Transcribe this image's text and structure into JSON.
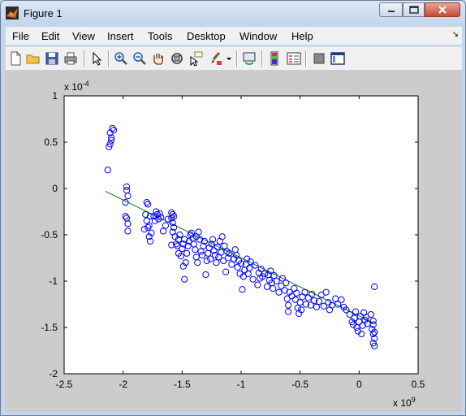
{
  "window": {
    "title": "Figure 1"
  },
  "menu": {
    "items": [
      "File",
      "Edit",
      "View",
      "Insert",
      "Tools",
      "Desktop",
      "Window",
      "Help"
    ]
  },
  "toolbar": {
    "buttons": [
      "new-figure",
      "open-file",
      "save-figure",
      "print-figure",
      "edit-plot",
      "zoom-in",
      "zoom-out",
      "pan",
      "rotate-3d",
      "data-cursor",
      "brush",
      "link-plot",
      "insert-colorbar",
      "insert-legend",
      "hide-plot-tools",
      "show-plot-tools"
    ]
  },
  "chart_data": {
    "type": "scatter",
    "xlim": [
      -2.5,
      0.5
    ],
    "ylim": [
      -2,
      1
    ],
    "x_ticks": [
      "-2.5",
      "-2",
      "-1.5",
      "-1",
      "-0.5",
      "0",
      "0.5"
    ],
    "y_ticks": [
      "1",
      "0.5",
      "0",
      "-0.5",
      "-1",
      "-1.5",
      "-2"
    ],
    "x_exponent": {
      "base": "x 10",
      "exp": "9"
    },
    "y_exponent": {
      "base": "x 10",
      "exp": "-4"
    },
    "marker_color": "#0000ff",
    "line_color": "#008000",
    "fit_line": {
      "x": [
        -2.15,
        0.12
      ],
      "y": [
        -0.03,
        -1.45
      ]
    },
    "points": [
      [
        -2.12,
        0.45
      ],
      [
        -2.11,
        0.48
      ],
      [
        -2.1,
        0.55
      ],
      [
        -2.09,
        0.65
      ],
      [
        -2.08,
        0.63
      ],
      [
        -2.11,
        0.6
      ],
      [
        -2.1,
        0.52
      ],
      [
        -2.13,
        0.2
      ],
      [
        -1.97,
        0.02
      ],
      [
        -1.97,
        -0.02
      ],
      [
        -1.96,
        -0.08
      ],
      [
        -1.98,
        -0.15
      ],
      [
        -1.97,
        -0.32
      ],
      [
        -1.96,
        -0.38
      ],
      [
        -1.98,
        -0.3
      ],
      [
        -1.96,
        -0.46
      ],
      [
        -1.8,
        -0.15
      ],
      [
        -1.79,
        -0.17
      ],
      [
        -1.81,
        -0.28
      ],
      [
        -1.8,
        -0.35
      ],
      [
        -1.79,
        -0.42
      ],
      [
        -1.82,
        -0.44
      ],
      [
        -1.78,
        -0.4
      ],
      [
        -1.77,
        -0.3
      ],
      [
        -1.78,
        -0.52
      ],
      [
        -1.77,
        -0.57
      ],
      [
        -1.76,
        -0.48
      ],
      [
        -1.74,
        -0.3
      ],
      [
        -1.73,
        -0.35
      ],
      [
        -1.72,
        -0.25
      ],
      [
        -1.71,
        -0.28
      ],
      [
        -1.7,
        -0.33
      ],
      [
        -1.69,
        -0.27
      ],
      [
        -1.68,
        -0.31
      ],
      [
        -1.66,
        -0.46
      ],
      [
        -1.64,
        -0.4
      ],
      [
        -1.62,
        -0.33
      ],
      [
        -1.59,
        -0.26
      ],
      [
        -1.58,
        -0.28
      ],
      [
        -1.59,
        -0.32
      ],
      [
        -1.58,
        -0.37
      ],
      [
        -1.57,
        -0.42
      ],
      [
        -1.57,
        -0.3
      ],
      [
        -1.58,
        -0.47
      ],
      [
        -1.56,
        -0.52
      ],
      [
        -1.59,
        -0.61
      ],
      [
        -1.55,
        -0.6
      ],
      [
        -1.54,
        -0.62
      ],
      [
        -1.53,
        -0.55
      ],
      [
        -1.52,
        -0.5
      ],
      [
        -1.53,
        -0.7
      ],
      [
        -1.51,
        -0.73
      ],
      [
        -1.5,
        -0.65
      ],
      [
        -1.49,
        -0.6
      ],
      [
        -1.48,
        -0.55
      ],
      [
        -1.49,
        -0.84
      ],
      [
        -1.48,
        -0.98
      ],
      [
        -1.47,
        -0.8
      ],
      [
        -1.46,
        -0.7
      ],
      [
        -1.45,
        -0.62
      ],
      [
        -1.44,
        -0.57
      ],
      [
        -1.43,
        -0.5
      ],
      [
        -1.42,
        -0.48
      ],
      [
        -1.41,
        -0.54
      ],
      [
        -1.4,
        -0.6
      ],
      [
        -1.39,
        -0.66
      ],
      [
        -1.38,
        -0.74
      ],
      [
        -1.37,
        -0.8
      ],
      [
        -1.38,
        -0.52
      ],
      [
        -1.36,
        -0.47
      ],
      [
        -1.35,
        -0.55
      ],
      [
        -1.34,
        -0.68
      ],
      [
        -1.33,
        -0.72
      ],
      [
        -1.32,
        -0.62
      ],
      [
        -1.31,
        -0.57
      ],
      [
        -1.3,
        -0.93
      ],
      [
        -1.29,
        -0.78
      ],
      [
        -1.28,
        -0.7
      ],
      [
        -1.27,
        -0.64
      ],
      [
        -1.26,
        -0.76
      ],
      [
        -1.25,
        -0.6
      ],
      [
        -1.24,
        -0.55
      ],
      [
        -1.23,
        -0.67
      ],
      [
        -1.22,
        -0.72
      ],
      [
        -1.21,
        -0.8
      ],
      [
        -1.2,
        -0.63
      ],
      [
        -1.19,
        -0.74
      ],
      [
        -1.18,
        -0.57
      ],
      [
        -1.17,
        -0.69
      ],
      [
        -1.16,
        -0.52
      ],
      [
        -1.15,
        -0.78
      ],
      [
        -1.14,
        -0.62
      ],
      [
        -1.13,
        -0.9
      ],
      [
        -1.12,
        -0.68
      ],
      [
        -1.11,
        -0.75
      ],
      [
        -1.1,
        -0.7
      ],
      [
        -1.08,
        -0.82
      ],
      [
        -1.06,
        -0.76
      ],
      [
        -1.05,
        -0.66
      ],
      [
        -1.04,
        -0.72
      ],
      [
        -1.03,
        -0.85
      ],
      [
        -1.02,
        -0.78
      ],
      [
        -1.01,
        -0.92
      ],
      [
        -1.0,
        -0.81
      ],
      [
        -0.99,
        -1.09
      ],
      [
        -0.98,
        -0.95
      ],
      [
        -0.97,
        -0.88
      ],
      [
        -0.96,
        -0.82
      ],
      [
        -0.95,
        -0.76
      ],
      [
        -0.94,
        -0.92
      ],
      [
        -0.93,
        -0.86
      ],
      [
        -0.92,
        -0.79
      ],
      [
        -0.9,
        -0.98
      ],
      [
        -0.88,
        -0.83
      ],
      [
        -0.86,
        -1.04
      ],
      [
        -0.85,
        -0.91
      ],
      [
        -0.84,
        -0.97
      ],
      [
        -0.83,
        -0.87
      ],
      [
        -0.82,
        -0.95
      ],
      [
        -0.8,
        -0.92
      ],
      [
        -0.78,
        -1.06
      ],
      [
        -0.77,
        -0.93
      ],
      [
        -0.76,
        -0.99
      ],
      [
        -0.75,
        -0.89
      ],
      [
        -0.74,
        -1.02
      ],
      [
        -0.73,
        -1.08
      ],
      [
        -0.72,
        -0.94
      ],
      [
        -0.7,
        -1.0
      ],
      [
        -0.68,
        -1.12
      ],
      [
        -0.66,
        -1.05
      ],
      [
        -0.65,
        -0.97
      ],
      [
        -0.63,
        -1.1
      ],
      [
        -0.62,
        -1.02
      ],
      [
        -0.61,
        -1.19
      ],
      [
        -0.6,
        -1.26
      ],
      [
        -0.6,
        -1.33
      ],
      [
        -0.59,
        -1.12
      ],
      [
        -0.57,
        -1.16
      ],
      [
        -0.55,
        -1.08
      ],
      [
        -0.54,
        -1.2
      ],
      [
        -0.53,
        -1.13
      ],
      [
        -0.52,
        -1.29
      ],
      [
        -0.51,
        -1.35
      ],
      [
        -0.5,
        -1.23
      ],
      [
        -0.49,
        -1.31
      ],
      [
        -0.48,
        -1.17
      ],
      [
        -0.46,
        -1.12
      ],
      [
        -0.45,
        -1.25
      ],
      [
        -0.43,
        -1.18
      ],
      [
        -0.41,
        -1.26
      ],
      [
        -0.4,
        -1.14
      ],
      [
        -0.38,
        -1.21
      ],
      [
        -0.36,
        -1.28
      ],
      [
        -0.34,
        -1.22
      ],
      [
        -0.32,
        -1.15
      ],
      [
        -0.3,
        -1.27
      ],
      [
        -0.28,
        -1.12
      ],
      [
        -0.26,
        -1.23
      ],
      [
        -0.25,
        -1.31
      ],
      [
        -0.23,
        -1.26
      ],
      [
        -0.2,
        -1.19
      ],
      [
        -0.18,
        -1.25
      ],
      [
        -0.15,
        -1.2
      ],
      [
        -0.13,
        -1.28
      ],
      [
        -0.11,
        -1.31
      ],
      [
        -0.08,
        -1.36
      ],
      [
        -0.06,
        -1.44
      ],
      [
        -0.05,
        -1.47
      ],
      [
        -0.04,
        -1.4
      ],
      [
        -0.03,
        -1.33
      ],
      [
        -0.02,
        -1.5
      ],
      [
        -0.01,
        -1.54
      ],
      [
        0.0,
        -1.44
      ],
      [
        0.01,
        -1.38
      ],
      [
        0.02,
        -1.57
      ],
      [
        0.03,
        -1.48
      ],
      [
        0.04,
        -1.34
      ],
      [
        0.05,
        -1.42
      ],
      [
        0.06,
        -1.39
      ],
      [
        0.07,
        -1.46
      ],
      [
        0.1,
        -1.36
      ],
      [
        0.11,
        -1.52
      ],
      [
        0.12,
        -1.47
      ],
      [
        0.12,
        -1.57
      ],
      [
        0.12,
        -1.67
      ],
      [
        0.13,
        -1.62
      ],
      [
        0.13,
        -1.7
      ],
      [
        0.13,
        -1.06
      ],
      [
        0.12,
        -1.43
      ],
      [
        0.13,
        -1.55
      ]
    ]
  }
}
